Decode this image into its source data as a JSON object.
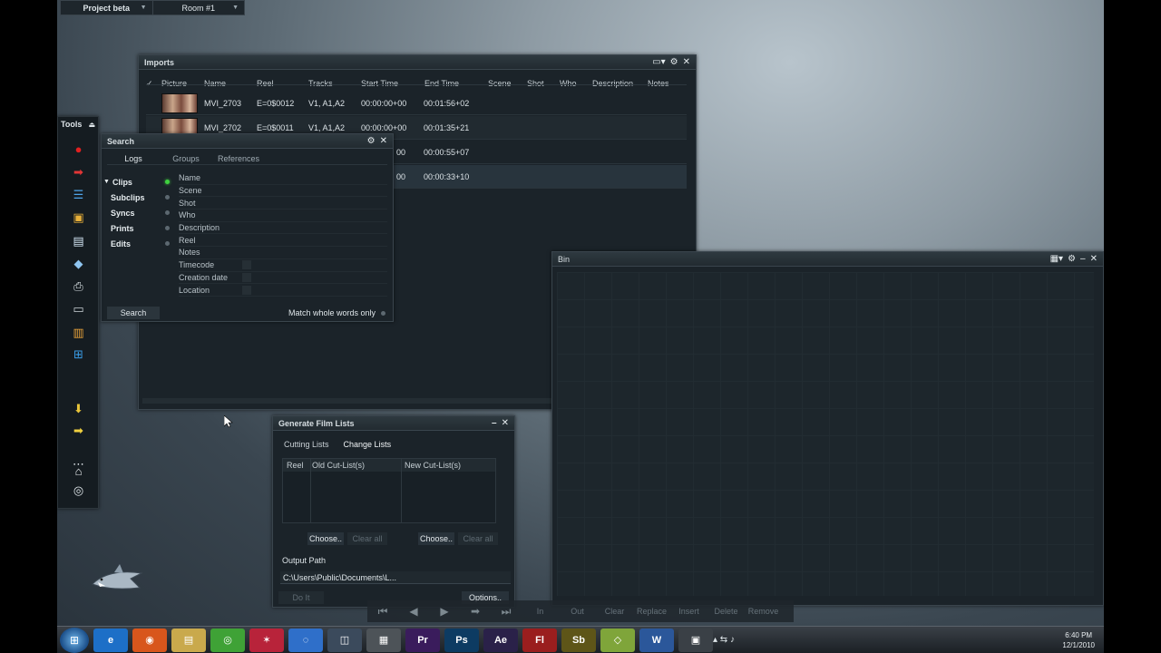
{
  "project_bar": {
    "project": "Project beta",
    "room": "Room #1"
  },
  "imports": {
    "title": "Imports",
    "columns": [
      "✓",
      "Picture",
      "Name",
      "Reel",
      "Tracks",
      "Start Time",
      "End Time",
      "Scene",
      "Shot",
      "Who",
      "Description",
      "Notes"
    ],
    "rows": [
      {
        "name": "MVI_2703",
        "reel": "E=0$0012",
        "tracks": "V1, A1,A2",
        "start": "00:00:00+00",
        "end": "00:01:56+02"
      },
      {
        "name": "MVI_2702",
        "reel": "E=0$0011",
        "tracks": "V1, A1,A2",
        "start": "00:00:00+00",
        "end": "00:01:35+21"
      },
      {
        "name": "",
        "reel": "",
        "tracks": "",
        "start": "00",
        "end": "00:00:55+07"
      },
      {
        "name": "",
        "reel": "",
        "tracks": "",
        "start": "00",
        "end": "00:00:33+10"
      }
    ]
  },
  "search": {
    "title": "Search",
    "tabs": [
      "Logs",
      "Groups",
      "References"
    ],
    "categories": [
      "Clips",
      "Subclips",
      "Syncs",
      "Prints",
      "Edits"
    ],
    "fields": [
      "Name",
      "Scene",
      "Shot",
      "Who",
      "Description",
      "Reel",
      "Notes",
      "Timecode",
      "Creation date",
      "Location"
    ],
    "search_button": "Search",
    "match_label": "Match whole words only"
  },
  "tools": {
    "title": "Tools"
  },
  "bin": {
    "title": "Bin"
  },
  "gfl": {
    "title": "Generate Film Lists",
    "tabs": [
      "Cutting Lists",
      "Change Lists"
    ],
    "columns": [
      "Reel",
      "Old Cut-List(s)",
      "New Cut-List(s)"
    ],
    "choose1": "Choose..",
    "clear1": "Clear all",
    "choose2": "Choose..",
    "clear2": "Clear all",
    "output_label": "Output Path",
    "output_path": "C:\\Users\\Public\\Documents\\L...",
    "do_it": "Do It",
    "options": "Options.."
  },
  "transport": {
    "labels": [
      "In",
      "Out",
      "Clear",
      "Replace",
      "Insert",
      "Delete",
      "Remove"
    ]
  },
  "taskbar": {
    "apps": [
      {
        "label": "e",
        "color": "#1d6fc7"
      },
      {
        "label": "◉",
        "color": "#d8561c"
      },
      {
        "label": "▤",
        "color": "#c9a94c"
      },
      {
        "label": "◎",
        "color": "#3fa236"
      },
      {
        "label": "✶",
        "color": "#b8233a"
      },
      {
        "label": "◌",
        "color": "#2f6fc9"
      },
      {
        "label": "◫",
        "color": "#3b4a5c"
      },
      {
        "label": "▦",
        "color": "#4d5358"
      },
      {
        "label": "Pr",
        "color": "#3a1c5c"
      },
      {
        "label": "Ps",
        "color": "#0d3b62"
      },
      {
        "label": "Ae",
        "color": "#2a2149"
      },
      {
        "label": "Fl",
        "color": "#9a1e1e"
      },
      {
        "label": "Sb",
        "color": "#5e5518"
      },
      {
        "label": "◇",
        "color": "#7fa53a"
      },
      {
        "label": "W",
        "color": "#2b579a"
      },
      {
        "label": "▣",
        "color": "#3a4046"
      }
    ],
    "time": "6:40 PM",
    "date": "12/1/2010"
  }
}
